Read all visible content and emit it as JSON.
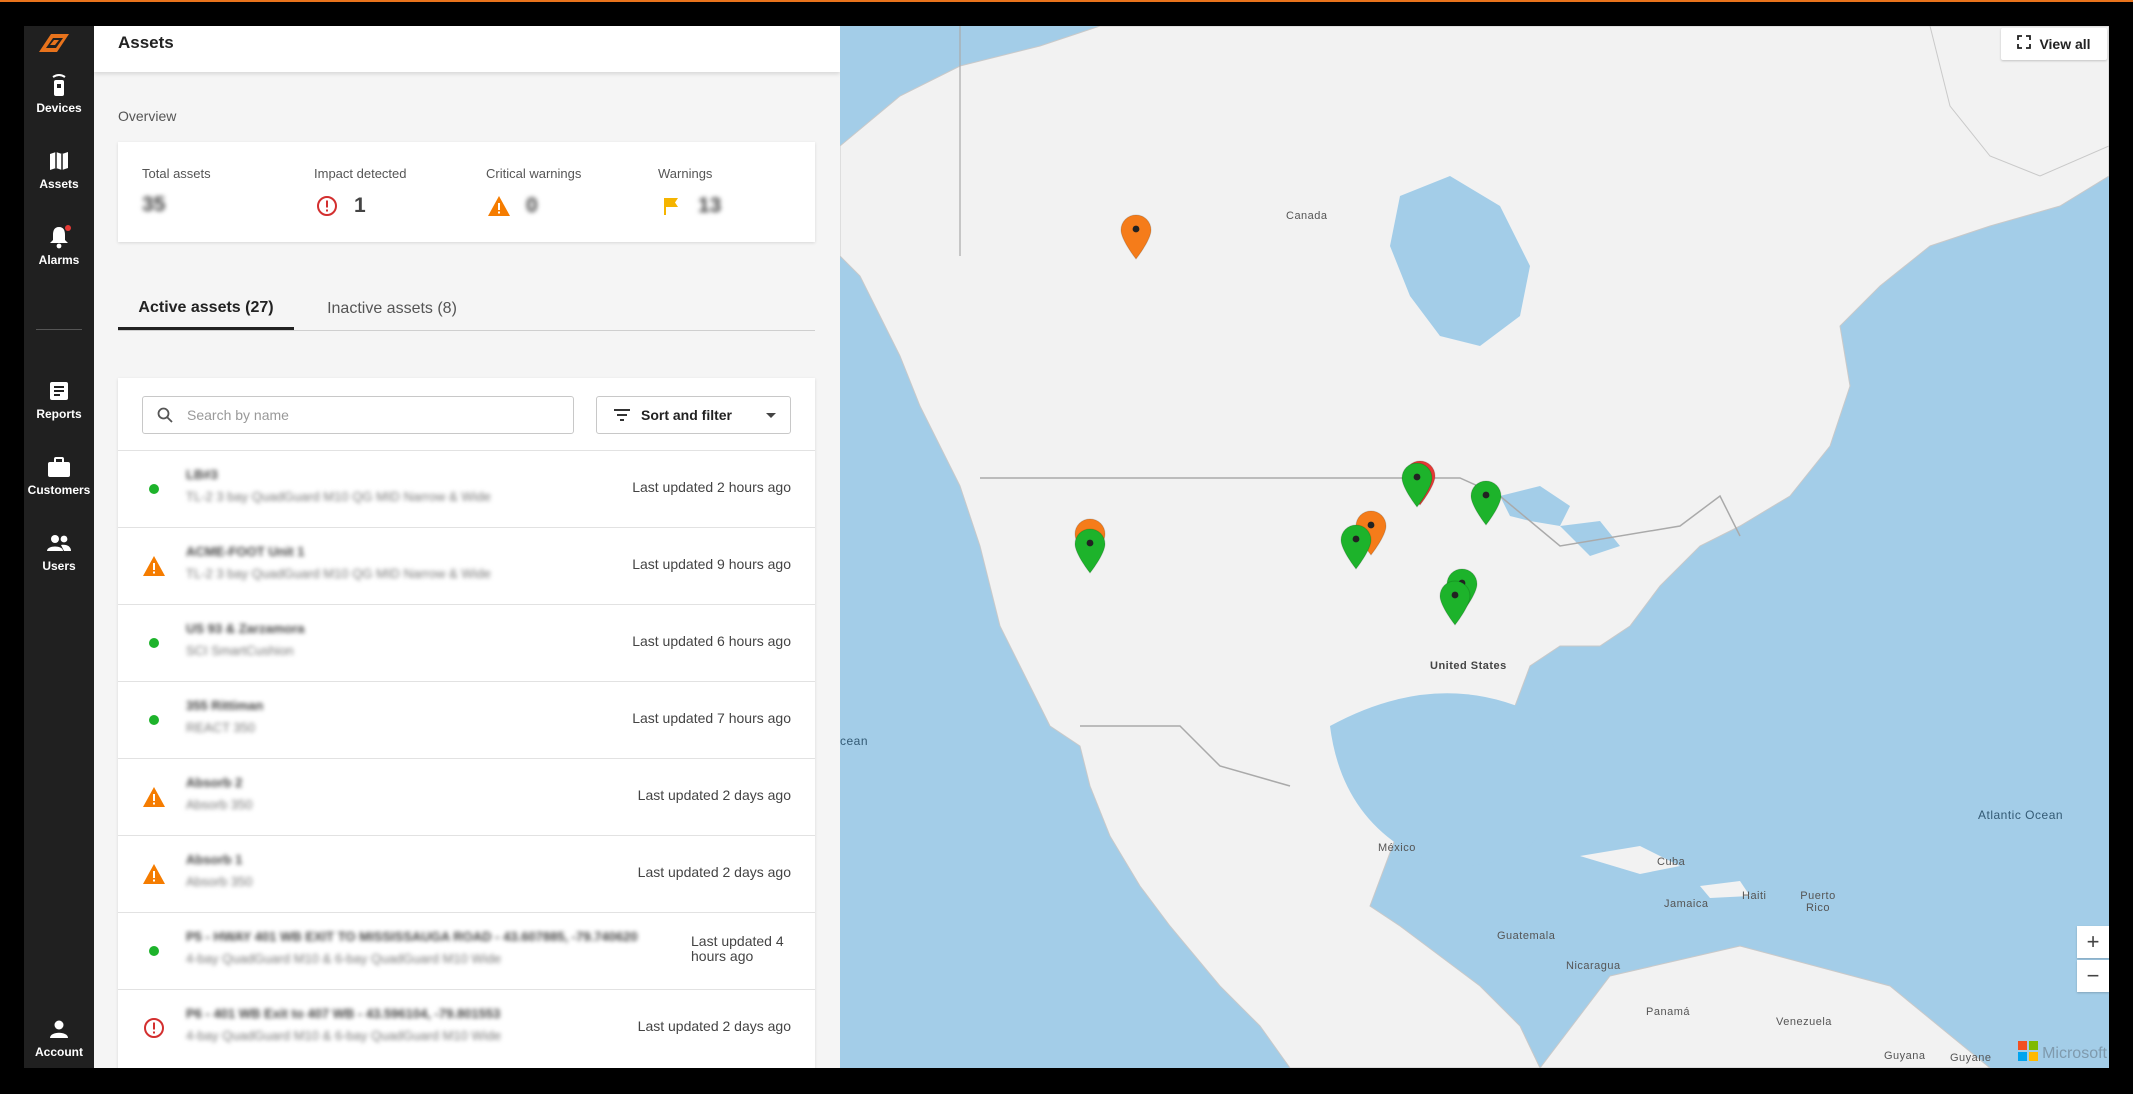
{
  "nav": {
    "items": [
      {
        "label": "Devices",
        "icon": "device-icon"
      },
      {
        "label": "Assets",
        "icon": "map-icon"
      },
      {
        "label": "Alarms",
        "icon": "bell-icon"
      },
      {
        "label": "Reports",
        "icon": "report-icon"
      },
      {
        "label": "Customers",
        "icon": "briefcase-icon"
      },
      {
        "label": "Users",
        "icon": "users-icon"
      }
    ],
    "account": {
      "label": "Account",
      "icon": "account-icon"
    }
  },
  "header": {
    "title": "Assets"
  },
  "overview": {
    "label": "Overview",
    "stats": [
      {
        "caption": "Total assets",
        "value": "35"
      },
      {
        "caption": "Impact detected",
        "value": "1",
        "icon": "impact-alert-icon",
        "color": "#d32f2f"
      },
      {
        "caption": "Critical warnings",
        "value": "0",
        "icon": "warning-triangle-icon",
        "color": "#f57c00"
      },
      {
        "caption": "Warnings",
        "value": "13",
        "icon": "flag-icon",
        "color": "#f5b400"
      }
    ]
  },
  "tabs": [
    {
      "label": "Active assets (27)",
      "active": true
    },
    {
      "label": "Inactive assets (8)",
      "active": false
    }
  ],
  "search": {
    "placeholder": "Search by name"
  },
  "sort": {
    "label": "Sort and filter"
  },
  "assets": [
    {
      "status": "ok",
      "name": "LB#3",
      "subtitle": "TL-2 3 bay QuadGuard M10 QG MID Narrow & Wide",
      "updated": "Last updated 2 hours ago"
    },
    {
      "status": "warning",
      "name": "ACME-FOOT Unit 1",
      "subtitle": "TL-2 3 bay QuadGuard M10 QG MID Narrow & Wide",
      "updated": "Last updated 9 hours ago"
    },
    {
      "status": "ok",
      "name": "US 93 & Zarzamora",
      "subtitle": "SCI SmartCushion",
      "updated": "Last updated 6 hours ago"
    },
    {
      "status": "ok",
      "name": "355 Rittiman",
      "subtitle": "REACT 350",
      "updated": "Last updated 7 hours ago"
    },
    {
      "status": "warning",
      "name": "Absorb 2",
      "subtitle": "Absorb 350",
      "updated": "Last updated 2 days ago"
    },
    {
      "status": "warning",
      "name": "Absorb 1",
      "subtitle": "Absorb 350",
      "updated": "Last updated 2 days ago"
    },
    {
      "status": "ok",
      "name": "P5 - HWAY 401 WB EXIT TO MISSISSAUGA ROAD - 43.607885, -79.740620",
      "subtitle": "4-bay QuadGuard M10 & 6-bay QuadGuard M10 Wide",
      "updated": "Last updated 4 hours ago"
    },
    {
      "status": "impact",
      "name": "P6 - 401 WB Exit to 407 WB - 43.596104, -79.801553",
      "subtitle": "4-bay QuadGuard M10 & 6-bay QuadGuard M10 Wide",
      "updated": "Last updated 2 days ago"
    }
  ],
  "map": {
    "view_all_label": "View all",
    "labels": {
      "canada": "Canada",
      "united_states": "United States",
      "mexico": "México",
      "cuba": "Cuba",
      "jamaica": "Jamaica",
      "haiti": "Haiti",
      "puerto_rico": "Puerto Rico",
      "guatemala": "Guatemala",
      "nicaragua": "Nicaragua",
      "panama": "Panamá",
      "venezuela": "Venezuela",
      "guyana": "Guyana",
      "guyane": "Guyane",
      "pacific": "cean",
      "atlantic": "Atlantic Ocean"
    },
    "zoom_in": "+",
    "zoom_out": "−",
    "attribution": "Microsoft",
    "colors": {
      "ok": "#1db32b",
      "warning": "#f57c1a",
      "impact": "#e53935",
      "water": "#a3cde8",
      "land": "#f2f2f2"
    },
    "pins": [
      {
        "status": "warning"
      },
      {
        "status": "impact"
      },
      {
        "status": "ok"
      },
      {
        "status": "ok"
      },
      {
        "status": "warning"
      },
      {
        "status": "ok"
      },
      {
        "status": "warning"
      },
      {
        "status": "ok"
      },
      {
        "status": "ok"
      },
      {
        "status": "ok"
      }
    ]
  }
}
